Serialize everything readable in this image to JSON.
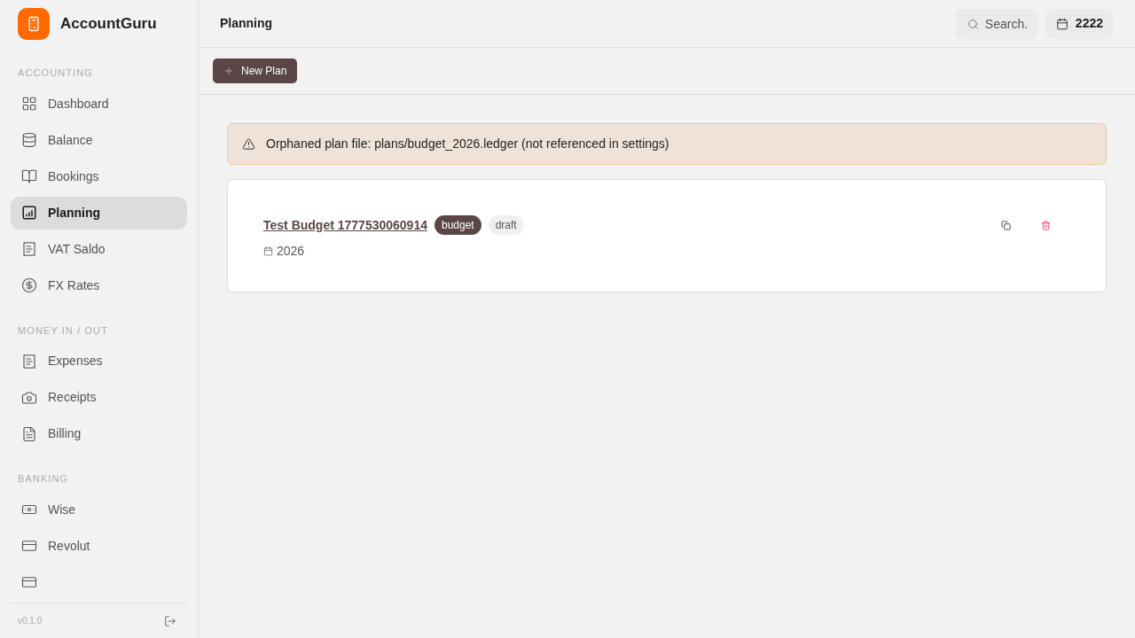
{
  "app": {
    "name": "AccountGuru"
  },
  "sidebar": {
    "sections": [
      {
        "heading": "ACCOUNTING",
        "items": [
          {
            "label": "Dashboard",
            "selected": false
          },
          {
            "label": "Balance",
            "selected": false
          },
          {
            "label": "Bookings",
            "selected": false
          },
          {
            "label": "Planning",
            "selected": true
          },
          {
            "label": "VAT Saldo",
            "selected": false
          },
          {
            "label": "FX Rates",
            "selected": false
          }
        ]
      },
      {
        "heading": "MONEY IN / OUT",
        "items": [
          {
            "label": "Expenses",
            "selected": false
          },
          {
            "label": "Receipts",
            "selected": false
          },
          {
            "label": "Billing",
            "selected": false
          }
        ]
      },
      {
        "heading": "BANKING",
        "items": [
          {
            "label": "Wise",
            "selected": false
          },
          {
            "label": "Revolut",
            "selected": false
          },
          {
            "selected": false
          }
        ]
      }
    ],
    "version": "v0.1.0"
  },
  "header": {
    "title": "Planning",
    "search": {
      "placeholder": "Search."
    },
    "year": "2222"
  },
  "toolbar": {
    "new_button": "New Plan"
  },
  "alert": {
    "message": "Orphaned plan file: plans/budget_2026.ledger (not referenced in settings)"
  },
  "plans": [
    {
      "name": "Test Budget 1777530060914",
      "type_tag": "budget",
      "status_tag": "draft",
      "year": "2026"
    }
  ]
}
